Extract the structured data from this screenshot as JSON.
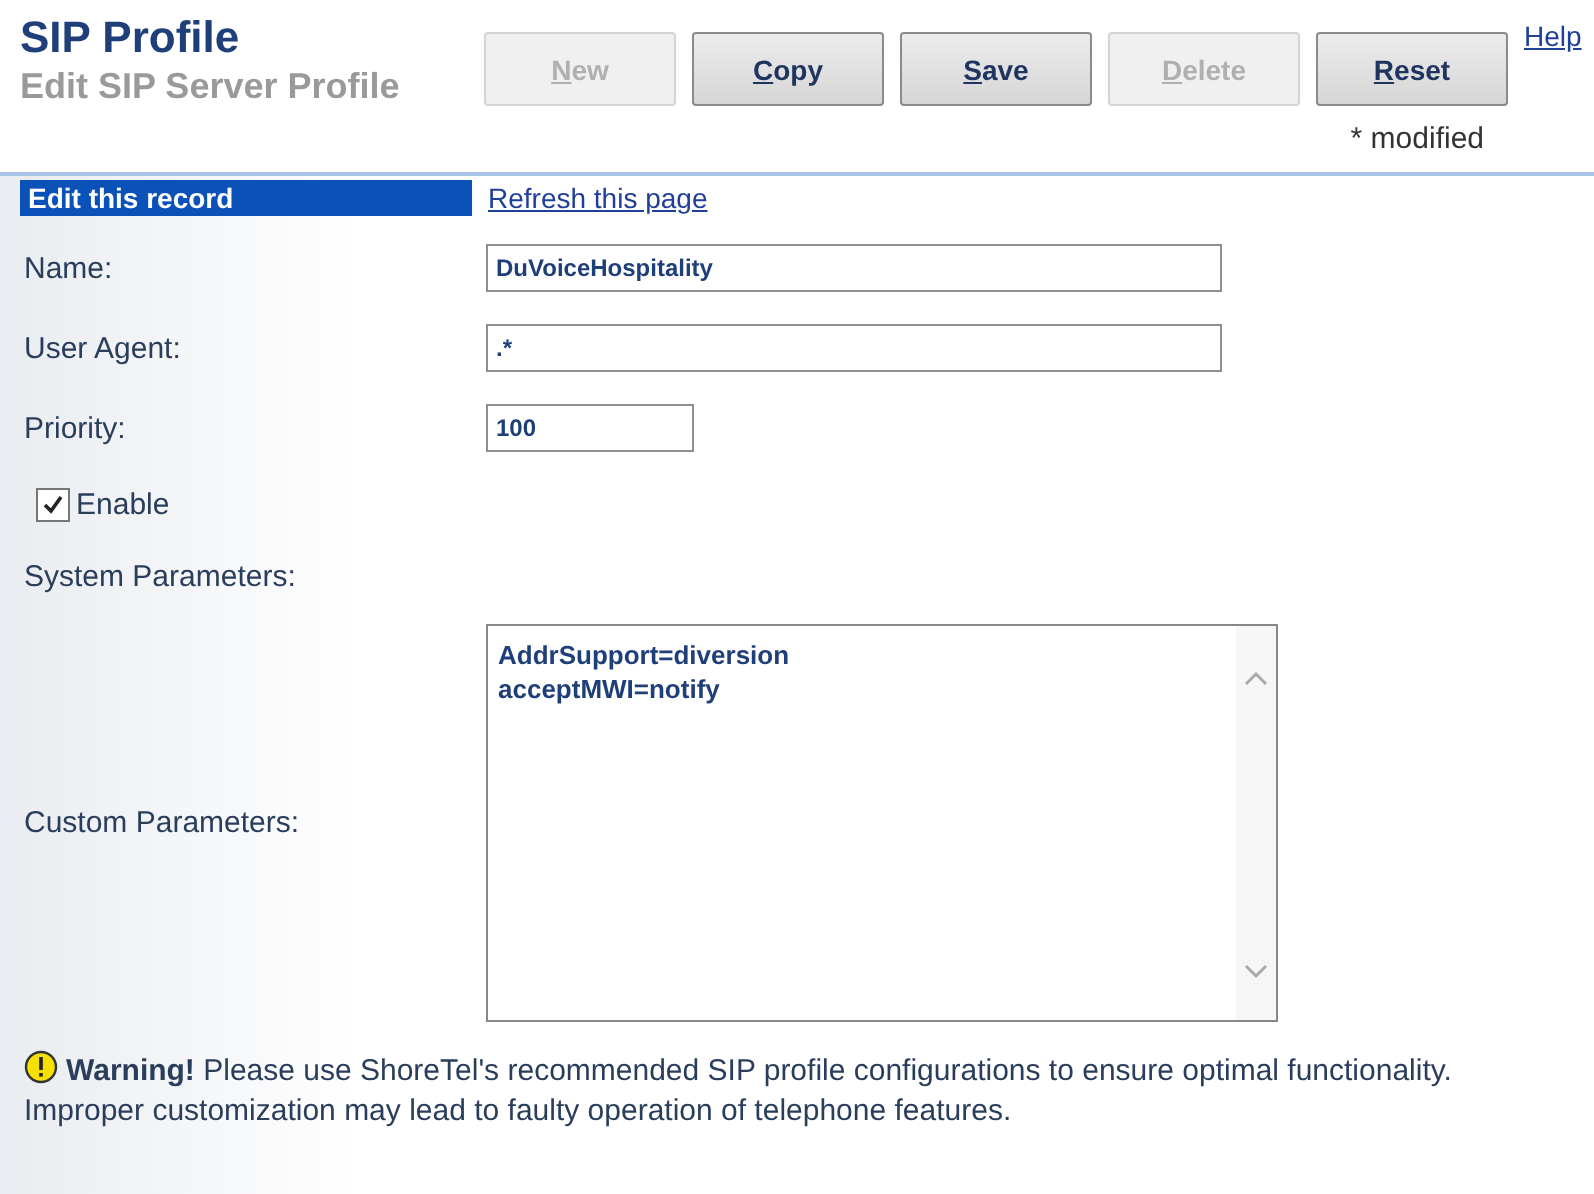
{
  "header": {
    "title": "SIP Profile",
    "subtitle": "Edit SIP Server Profile",
    "help_link": "Help",
    "modified_note": "* modified"
  },
  "buttons": [
    {
      "label": "New",
      "disabled": true
    },
    {
      "label": "Copy",
      "disabled": false
    },
    {
      "label": "Save",
      "disabled": false
    },
    {
      "label": "Delete",
      "disabled": true
    },
    {
      "label": "Reset",
      "disabled": false
    }
  ],
  "record_bar": {
    "title": "Edit this record",
    "refresh_link": "Refresh this page"
  },
  "fields": [
    {
      "label": "Name:",
      "value": "DuVoiceHospitality",
      "kind": "wide"
    },
    {
      "label": "User Agent:",
      "value": ".*",
      "kind": "wide"
    },
    {
      "label": "Priority:",
      "value": "100",
      "kind": "short"
    }
  ],
  "enable": {
    "label": "Enable",
    "checked": true
  },
  "system_parameters": {
    "label": "System Parameters:"
  },
  "custom_parameters": {
    "label": "Custom Parameters:",
    "lines": [
      "AddrSupport=diversion",
      "acceptMWI=notify"
    ]
  },
  "warning": {
    "title": "Warning!",
    "text": "Please use ShoreTel's recommended SIP profile configurations to ensure optimal functionality. Improper customization may lead to faulty operation of telephone features."
  }
}
